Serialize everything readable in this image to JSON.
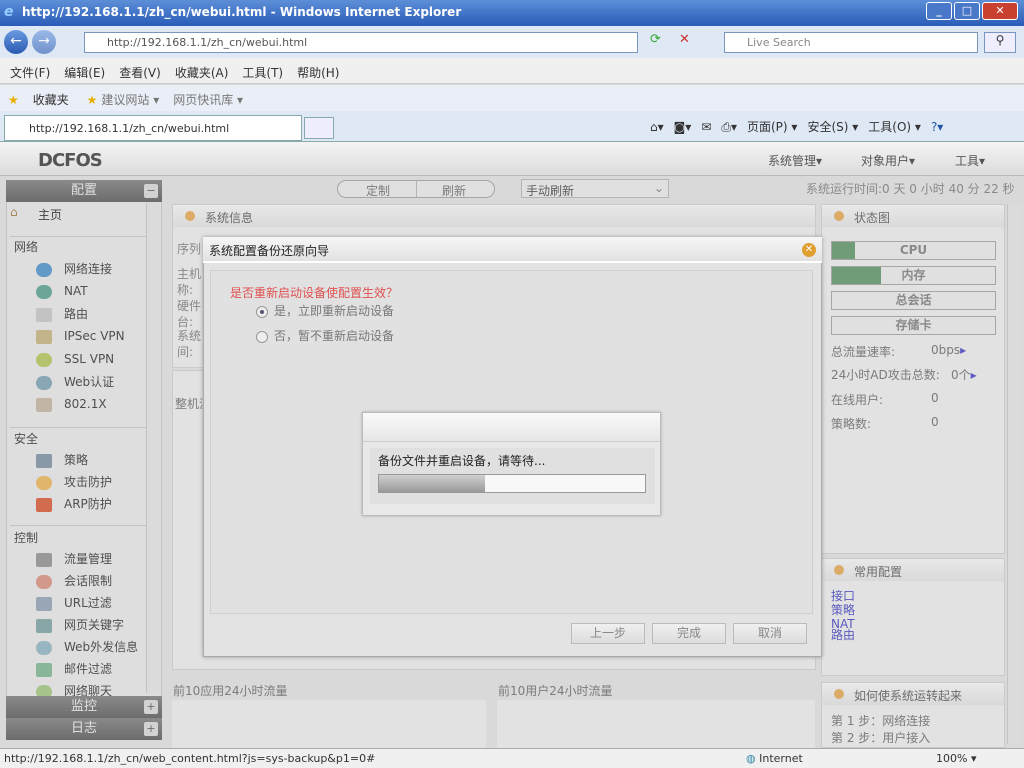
{
  "browser": {
    "title": "http://192.168.1.1/zh_cn/webui.html - Windows Internet Explorer",
    "address": "http://192.168.1.1/zh_cn/webui.html",
    "search_placeholder": "Live Search",
    "tab_title": "http://192.168.1.1/zh_cn/webui.html",
    "menu": [
      "文件(F)",
      "编辑(E)",
      "查看(V)",
      "收藏夹(A)",
      "工具(T)",
      "帮助(H)"
    ],
    "favorites": [
      "收藏夹",
      "建议网站 ▾",
      "网页快讯库 ▾"
    ],
    "commands": [
      "页面(P) ▾",
      "安全(S) ▾",
      "工具(O) ▾"
    ],
    "status_url": "http://192.168.1.1/zh_cn/web_content.html?js=sys-backup&p1=0#",
    "zone": "Internet",
    "zoom": "100%"
  },
  "app": {
    "logo": "DCFOS",
    "top_menu": [
      "系统管理▾",
      "对象用户▾",
      "工具▾"
    ],
    "toolbar": {
      "customize": "定制",
      "refresh": "刷新",
      "refresh_mode": "手动刷新",
      "uptime": "系统运行时间:0 天 0 小时 40 分 22 秒"
    },
    "sidebar": {
      "config": "配置",
      "home": "主页",
      "groups": [
        {
          "label": "网络",
          "items": [
            "网络连接",
            "NAT",
            "路由",
            "IPSec VPN",
            "SSL VPN",
            "Web认证",
            "802.1X"
          ]
        },
        {
          "label": "安全",
          "items": [
            "策略",
            "攻击防护",
            "ARP防护"
          ]
        },
        {
          "label": "控制",
          "items": [
            "流量管理",
            "会话限制",
            "URL过滤",
            "网页关键字",
            "Web外发信息",
            "邮件过滤",
            "网络聊天"
          ]
        }
      ],
      "monitor": "监控",
      "log": "日志"
    },
    "panels": {
      "sysinfo": "系统信息",
      "sysinfo_partial": [
        "序列",
        "主机称:",
        "硬件台:",
        "系统间:"
      ],
      "whole": "整机流",
      "top_apps": "前10应用24小时流量",
      "top_users": "前10用户24小时流量",
      "status": {
        "title": "状态图",
        "bars": [
          {
            "label": "CPU",
            "percent": 14
          },
          {
            "label": "内存",
            "percent": 30
          },
          {
            "label": "总会话",
            "percent": 0
          },
          {
            "label": "存储卡",
            "percent": 0
          }
        ],
        "rows": [
          {
            "label": "总流量速率:",
            "value": "0bps"
          },
          {
            "label": "24小时AD攻击总数:",
            "value": "0个"
          },
          {
            "label": "在线用户:",
            "value": "0"
          },
          {
            "label": "策略数:",
            "value": "0"
          }
        ]
      },
      "common": {
        "title": "常用配置",
        "links": [
          "接口",
          "策略",
          "NAT",
          "路由"
        ]
      },
      "howto": {
        "title": "如何使系统运转起来",
        "steps": [
          "第 1 步：网络连接",
          "第 2 步：用户接入"
        ]
      }
    }
  },
  "dialog": {
    "title": "系统配置备份还原向导",
    "question": "是否重新启动设备使配置生效？",
    "options": [
      "是，立即重新启动设备",
      "否，暂不重新启动设备"
    ],
    "buttons": [
      "上一步",
      "完成",
      "取消"
    ]
  },
  "progress": {
    "text": "备份文件并重启设备，请等待...",
    "percent": 40
  }
}
